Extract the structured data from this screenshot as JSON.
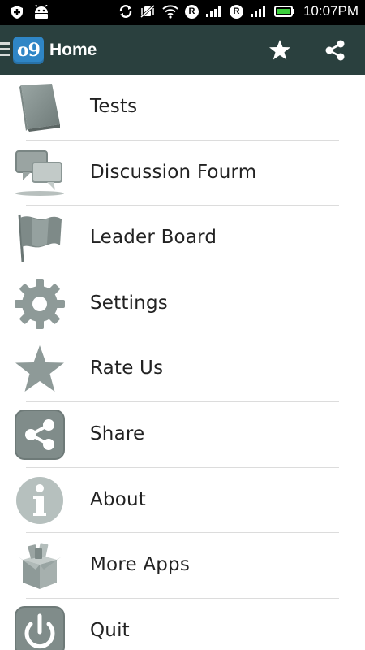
{
  "status_bar": {
    "time": "10:07PM",
    "carrier_badge_1": "R",
    "carrier_badge_2": "R"
  },
  "app_bar": {
    "logo_text": "o9",
    "title": "Home"
  },
  "menu": {
    "items": [
      {
        "label": "Tests",
        "icon": "book-icon"
      },
      {
        "label": "Discussion Fourm",
        "icon": "chat-bubbles-icon"
      },
      {
        "label": "Leader Board",
        "icon": "flag-icon"
      },
      {
        "label": "Settings",
        "icon": "gear-icon"
      },
      {
        "label": "Rate Us",
        "icon": "star-icon"
      },
      {
        "label": "Share",
        "icon": "share-icon"
      },
      {
        "label": "About",
        "icon": "info-icon"
      },
      {
        "label": "More Apps",
        "icon": "box-icon"
      },
      {
        "label": "Quit",
        "icon": "power-icon"
      }
    ]
  },
  "colors": {
    "app_bar": "#2a403e",
    "icon_gray": "#8a9694",
    "logo_blue": "#2f86c6"
  }
}
